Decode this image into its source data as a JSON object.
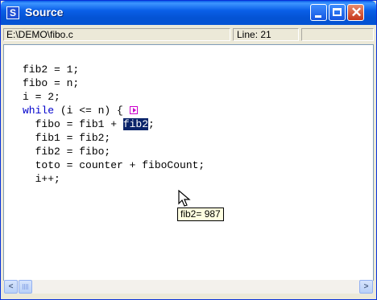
{
  "window": {
    "title": "Source",
    "app_icon_letter": "S",
    "controls": {
      "close_glyph": "✕"
    }
  },
  "statusbar": {
    "path": "E:\\DEMO\\fibo.c",
    "line": "Line: 21"
  },
  "code": {
    "lines": [
      "fib2 = 1;",
      "fibo = n;",
      "i = 2;",
      "while (i <= n) {",
      "  fibo = fib1 + fib2;",
      "  fib1 = fib2;",
      "  fib2 = fibo;",
      "  toto = counter + fiboCount;",
      "  i++;"
    ],
    "keyword": "while",
    "highlighted_token": "fib2"
  },
  "tooltip": {
    "text": "fib2= 987"
  },
  "scrollbar": {
    "left_glyph": "<",
    "right_glyph": ">"
  },
  "colors": {
    "selection": "#0a246a",
    "keyword": "#0000cc",
    "breakpoint": "#cc00cc"
  }
}
